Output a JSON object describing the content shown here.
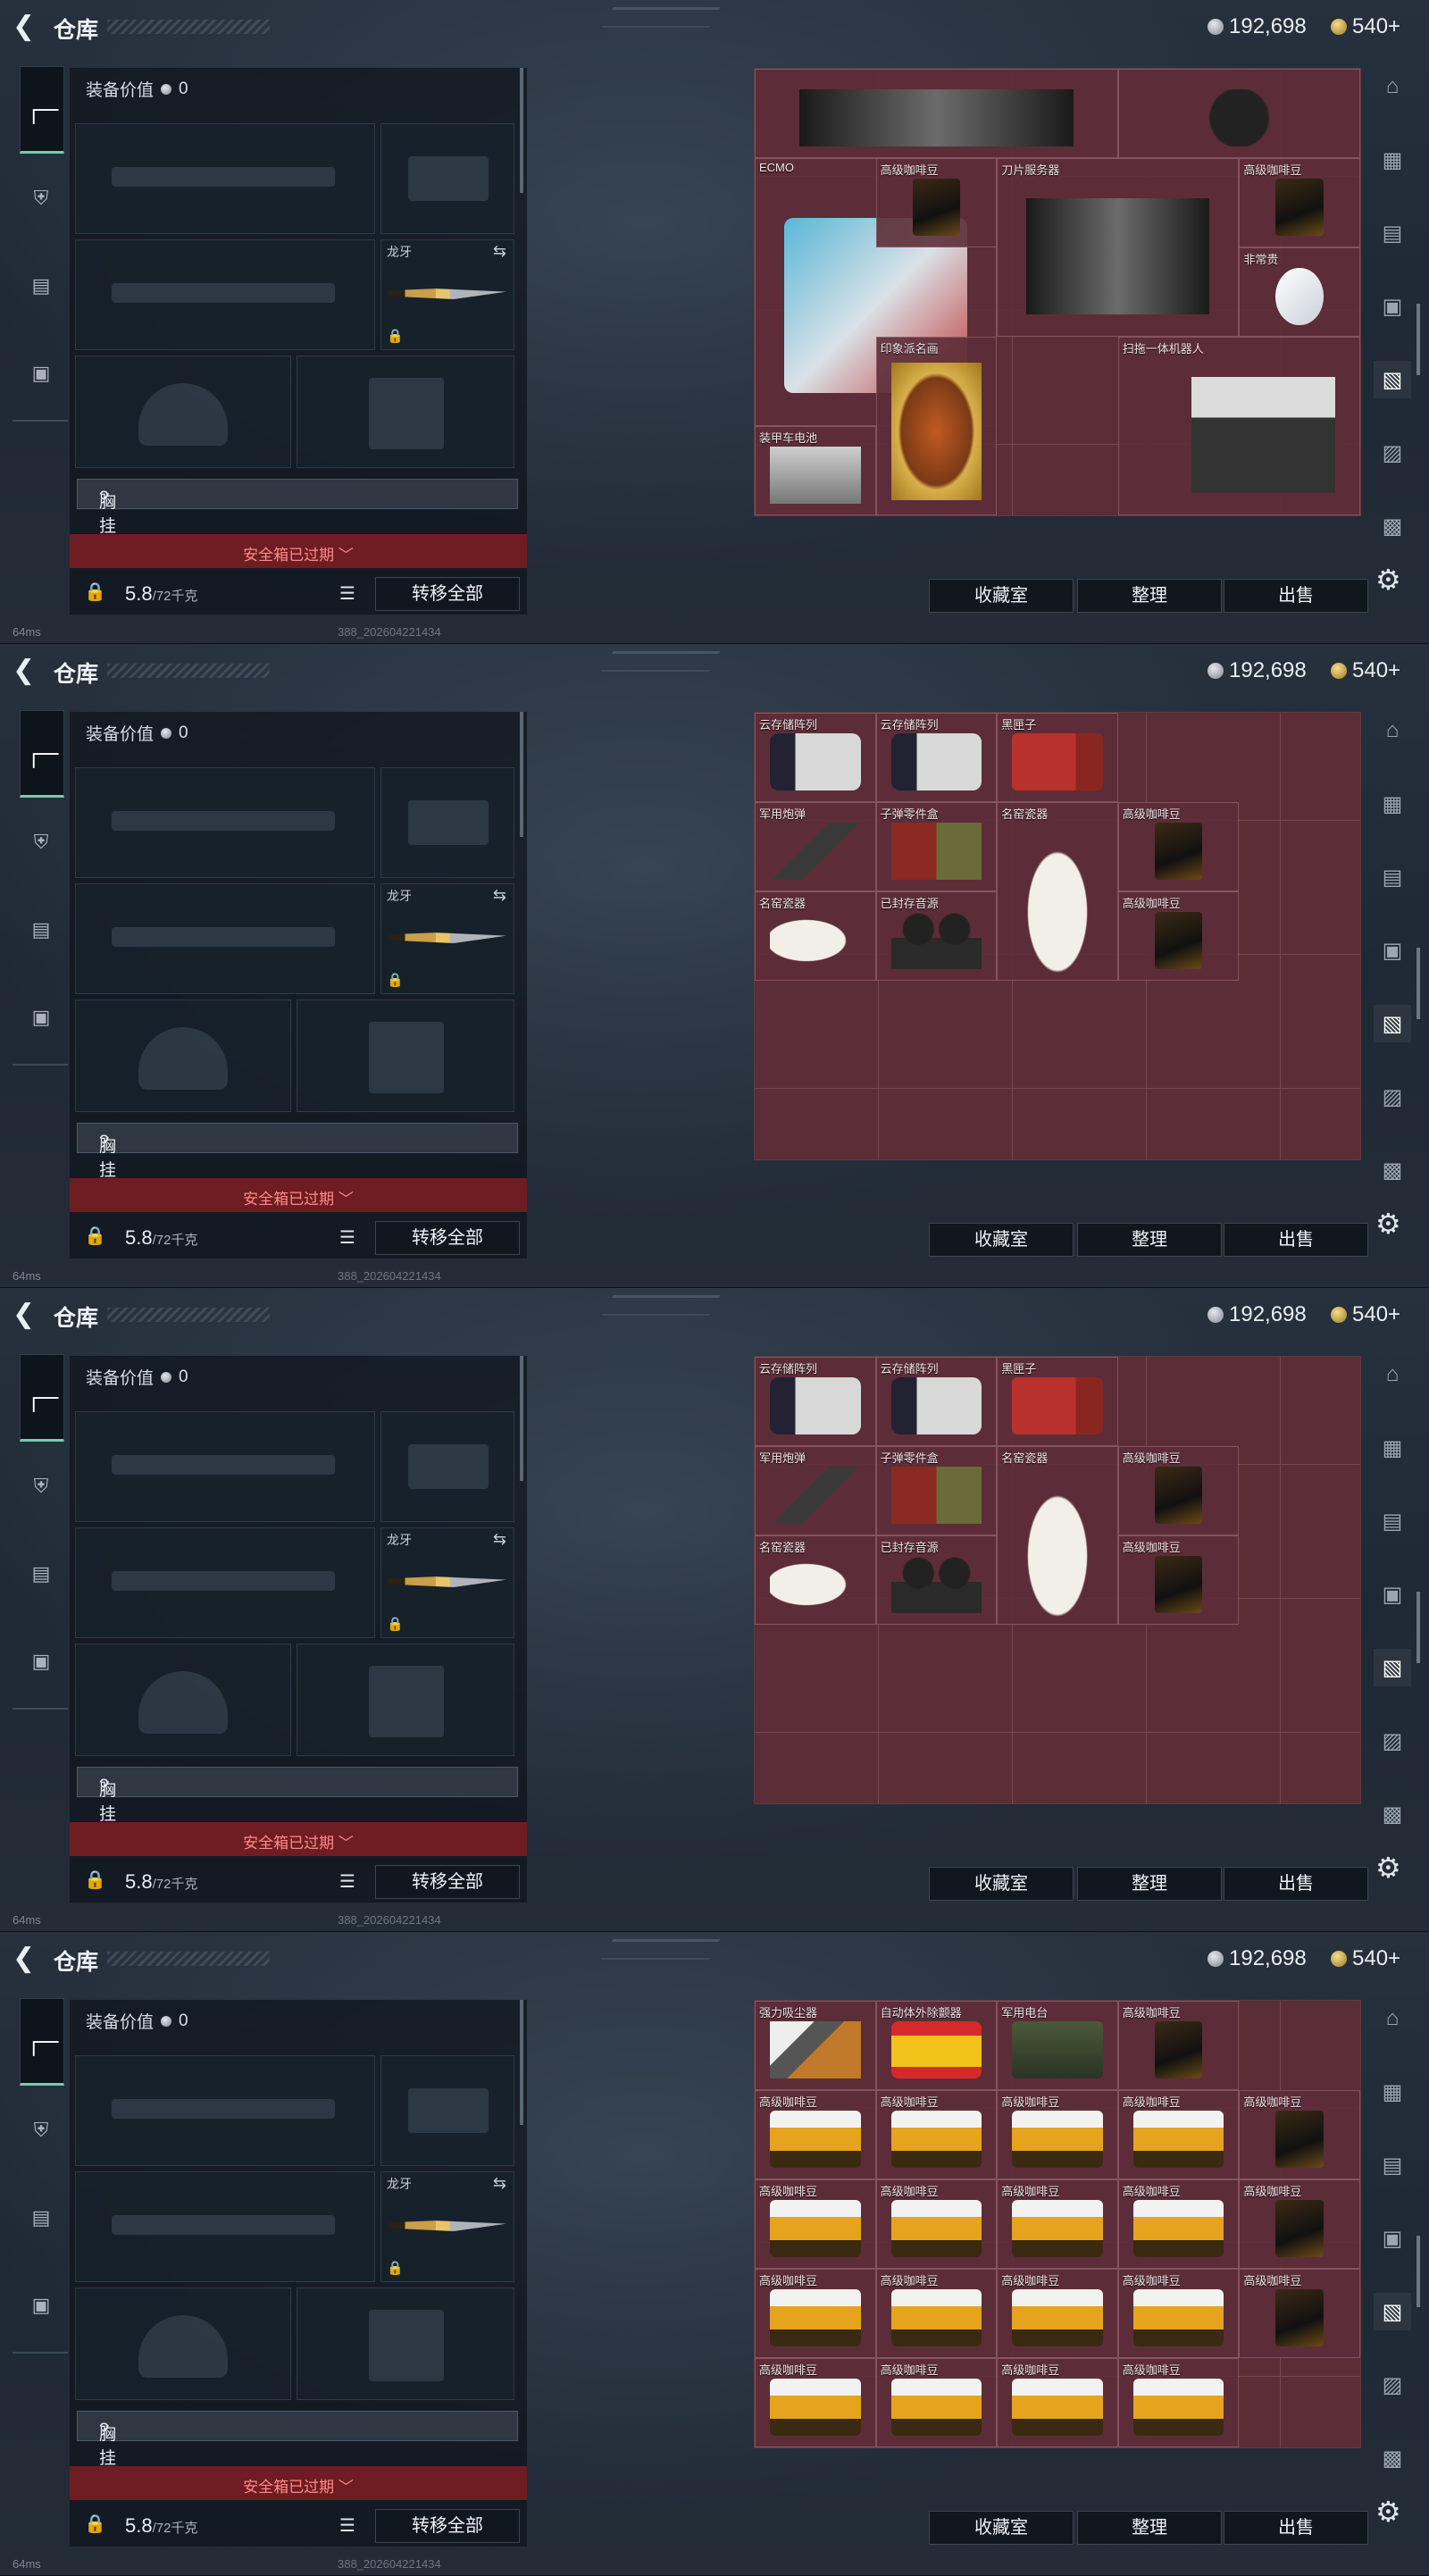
{
  "header": {
    "title": "仓库",
    "back_icon": "back-arrow-icon"
  },
  "currency": {
    "silver": "192,698",
    "gold": "540+"
  },
  "left_tabs": [
    {
      "name": "weapon-tab",
      "icon": "gun-icon",
      "active": true
    },
    {
      "name": "armor-tab",
      "icon": "armor-icon",
      "active": false
    },
    {
      "name": "backpack-tab",
      "icon": "backpack-icon",
      "active": false
    },
    {
      "name": "case-tab",
      "icon": "briefcase-icon",
      "active": false
    }
  ],
  "equipment": {
    "value_label": "装备价值",
    "value": "0",
    "melee_name": "龙牙",
    "chest_rig_label": "胸挂",
    "chest_rig_hint": "?",
    "safe_case_expired": "安全箱已过期 ﹀",
    "weight_current": "5.8",
    "weight_max": "/72千克",
    "transfer_all": "转移全部"
  },
  "stash_buttons": {
    "collection": "收藏室",
    "sort": "整理",
    "sell": "出售"
  },
  "status": {
    "ping": "64ms",
    "build": "388_202604221434"
  },
  "colors": {
    "stash_bg": "#5a2d37",
    "safe_bar": "#6e1d22",
    "accent_tab": "#6fd0ad"
  },
  "panels": [
    {
      "items": [
        {
          "name": "",
          "c": 0,
          "r": 0,
          "w": 3,
          "h": 1,
          "art": "server"
        },
        {
          "name": "",
          "c": 3,
          "r": 0,
          "w": 2,
          "h": 1,
          "art": "cable"
        },
        {
          "name": "刀片服务器",
          "c": 2,
          "r": 1,
          "w": 2,
          "h": 2,
          "art": "server"
        },
        {
          "name": "高级咖啡豆",
          "c": 4,
          "r": 1,
          "w": 1,
          "h": 1,
          "art": "coffee"
        },
        {
          "name": "ECMO",
          "c": 0,
          "r": 1,
          "w": 2,
          "h": 3,
          "art": "ecmo"
        },
        {
          "name": "高级咖啡豆",
          "c": 1,
          "r": 1,
          "w": 1,
          "h": 1,
          "art": "coffee"
        },
        {
          "name": "非常贵",
          "c": 4,
          "r": 2,
          "w": 1,
          "h": 1,
          "art": "diamond"
        },
        {
          "name": "印象派名画",
          "c": 1,
          "r": 3,
          "w": 1,
          "h": 2,
          "art": "painting"
        },
        {
          "name": "扫拖一体机器人",
          "c": 3,
          "r": 3,
          "w": 2,
          "h": 2,
          "art": "robot"
        },
        {
          "name": "装甲车电池",
          "c": 0,
          "r": 4,
          "w": 1,
          "h": 1,
          "art": "battery"
        }
      ]
    },
    {
      "items": [
        {
          "name": "云存储阵列",
          "c": 0,
          "r": 0,
          "w": 1,
          "h": 1,
          "art": "storage"
        },
        {
          "name": "云存储阵列",
          "c": 1,
          "r": 0,
          "w": 1,
          "h": 1,
          "art": "storage"
        },
        {
          "name": "黑匣子",
          "c": 2,
          "r": 0,
          "w": 1,
          "h": 1,
          "art": "blackbox"
        },
        {
          "name": "军用炮弹",
          "c": 0,
          "r": 1,
          "w": 1,
          "h": 1,
          "art": "shell"
        },
        {
          "name": "子弹零件盒",
          "c": 1,
          "r": 1,
          "w": 1,
          "h": 1,
          "art": "ammo"
        },
        {
          "name": "名窑瓷器",
          "c": 2,
          "r": 1,
          "w": 1,
          "h": 2,
          "art": "vase"
        },
        {
          "name": "高级咖啡豆",
          "c": 3,
          "r": 1,
          "w": 1,
          "h": 1,
          "art": "coffee"
        },
        {
          "name": "名窑瓷器",
          "c": 0,
          "r": 2,
          "w": 1,
          "h": 1,
          "art": "vaseh"
        },
        {
          "name": "已封存音源",
          "c": 1,
          "r": 2,
          "w": 1,
          "h": 1,
          "art": "reel"
        },
        {
          "name": "高级咖啡豆",
          "c": 3,
          "r": 2,
          "w": 1,
          "h": 1,
          "art": "coffee"
        }
      ]
    },
    {
      "items": [
        {
          "name": "云存储阵列",
          "c": 0,
          "r": 0,
          "w": 1,
          "h": 1,
          "art": "storage"
        },
        {
          "name": "云存储阵列",
          "c": 1,
          "r": 0,
          "w": 1,
          "h": 1,
          "art": "storage"
        },
        {
          "name": "黑匣子",
          "c": 2,
          "r": 0,
          "w": 1,
          "h": 1,
          "art": "blackbox"
        },
        {
          "name": "军用炮弹",
          "c": 0,
          "r": 1,
          "w": 1,
          "h": 1,
          "art": "shell"
        },
        {
          "name": "子弹零件盒",
          "c": 1,
          "r": 1,
          "w": 1,
          "h": 1,
          "art": "ammo"
        },
        {
          "name": "名窑瓷器",
          "c": 2,
          "r": 1,
          "w": 1,
          "h": 2,
          "art": "vase"
        },
        {
          "name": "高级咖啡豆",
          "c": 3,
          "r": 1,
          "w": 1,
          "h": 1,
          "art": "coffee"
        },
        {
          "name": "名窑瓷器",
          "c": 0,
          "r": 2,
          "w": 1,
          "h": 1,
          "art": "vaseh"
        },
        {
          "name": "已封存音源",
          "c": 1,
          "r": 2,
          "w": 1,
          "h": 1,
          "art": "reel"
        },
        {
          "name": "高级咖啡豆",
          "c": 3,
          "r": 2,
          "w": 1,
          "h": 1,
          "art": "coffee"
        }
      ]
    },
    {
      "items": [
        {
          "name": "强力吸尘器",
          "c": 0,
          "r": 0,
          "w": 1,
          "h": 1,
          "art": "vacuum"
        },
        {
          "name": "自动体外除颤器",
          "c": 1,
          "r": 0,
          "w": 1,
          "h": 1,
          "art": "aed"
        },
        {
          "name": "军用电台",
          "c": 2,
          "r": 0,
          "w": 1,
          "h": 1,
          "art": "radio"
        },
        {
          "name": "高级咖啡豆",
          "c": 3,
          "r": 0,
          "w": 1,
          "h": 1,
          "art": "coffee"
        },
        {
          "name": "高级咖啡豆",
          "c": 0,
          "r": 1,
          "w": 1,
          "h": 1,
          "art": "coin"
        },
        {
          "name": "高级咖啡豆",
          "c": 1,
          "r": 1,
          "w": 1,
          "h": 1,
          "art": "coin"
        },
        {
          "name": "高级咖啡豆",
          "c": 2,
          "r": 1,
          "w": 1,
          "h": 1,
          "art": "coin"
        },
        {
          "name": "高级咖啡豆",
          "c": 3,
          "r": 1,
          "w": 1,
          "h": 1,
          "art": "coin"
        },
        {
          "name": "高级咖啡豆",
          "c": 4,
          "r": 1,
          "w": 1,
          "h": 1,
          "art": "coffee"
        },
        {
          "name": "高级咖啡豆",
          "c": 0,
          "r": 2,
          "w": 1,
          "h": 1,
          "art": "coin"
        },
        {
          "name": "高级咖啡豆",
          "c": 1,
          "r": 2,
          "w": 1,
          "h": 1,
          "art": "coin"
        },
        {
          "name": "高级咖啡豆",
          "c": 2,
          "r": 2,
          "w": 1,
          "h": 1,
          "art": "coin"
        },
        {
          "name": "高级咖啡豆",
          "c": 3,
          "r": 2,
          "w": 1,
          "h": 1,
          "art": "coin"
        },
        {
          "name": "高级咖啡豆",
          "c": 4,
          "r": 2,
          "w": 1,
          "h": 1,
          "art": "coffee"
        },
        {
          "name": "高级咖啡豆",
          "c": 0,
          "r": 3,
          "w": 1,
          "h": 1,
          "art": "coin"
        },
        {
          "name": "高级咖啡豆",
          "c": 1,
          "r": 3,
          "w": 1,
          "h": 1,
          "art": "coin"
        },
        {
          "name": "高级咖啡豆",
          "c": 2,
          "r": 3,
          "w": 1,
          "h": 1,
          "art": "coin"
        },
        {
          "name": "高级咖啡豆",
          "c": 3,
          "r": 3,
          "w": 1,
          "h": 1,
          "art": "coin"
        },
        {
          "name": "高级咖啡豆",
          "c": 4,
          "r": 3,
          "w": 1,
          "h": 1,
          "art": "coffee"
        },
        {
          "name": "高级咖啡豆",
          "c": 0,
          "r": 4,
          "w": 1,
          "h": 1,
          "art": "coin"
        },
        {
          "name": "高级咖啡豆",
          "c": 1,
          "r": 4,
          "w": 1,
          "h": 1,
          "art": "coin"
        },
        {
          "name": "高级咖啡豆",
          "c": 2,
          "r": 4,
          "w": 1,
          "h": 1,
          "art": "coin"
        },
        {
          "name": "高级咖啡豆",
          "c": 3,
          "r": 4,
          "w": 1,
          "h": 1,
          "art": "coin"
        }
      ]
    }
  ]
}
